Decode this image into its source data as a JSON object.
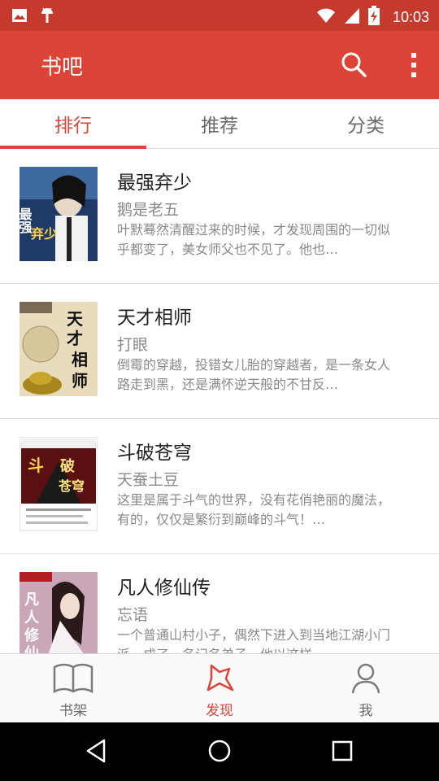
{
  "status_bar": {
    "time": "10:03",
    "icons": [
      "image-icon",
      "android-icon",
      "wifi-icon",
      "signal-icon",
      "battery-charging-icon"
    ]
  },
  "app_bar": {
    "title": "书吧",
    "actions": [
      "search-icon",
      "more-vert-icon"
    ]
  },
  "tabs": [
    {
      "label": "排行",
      "active": true
    },
    {
      "label": "推荐",
      "active": false
    },
    {
      "label": "分类",
      "active": false
    }
  ],
  "books": [
    {
      "title": "最强弃少",
      "author": "鹅是老五",
      "description": "叶默蓦然清醒过来的时候，才发现周围的一切似乎都变了，美女师父也不见了。他也…",
      "cover_text": "最强弃少"
    },
    {
      "title": "天才相师",
      "author": "打眼",
      "description": "倒霉的穿越，投错女儿胎的穿越者，是一条女人路走到黑，还是满怀逆天般的不甘反…",
      "cover_text": "天才相师"
    },
    {
      "title": "斗破苍穹",
      "author": "天蚕土豆",
      "description": "这里是属于斗气的世界，没有花俏艳丽的魔法，有的，仅仅是繁衍到巅峰的斗气！…",
      "cover_text": "斗破苍穹"
    },
    {
      "title": "凡人修仙传",
      "author": "忘语",
      "description": "一个普通山村小子，偶然下进入到当地江湖小门派，成了一名记名弟子。他以这样…",
      "cover_text": "凡人修仙传"
    }
  ],
  "bottom_nav": [
    {
      "label": "书架",
      "icon": "book-icon",
      "active": false
    },
    {
      "label": "发现",
      "icon": "star-icon",
      "active": true
    },
    {
      "label": "我",
      "icon": "person-icon",
      "active": false
    }
  ],
  "system_nav": [
    "back-icon",
    "home-icon",
    "recents-icon"
  ],
  "colors": {
    "primary": "#dc4437",
    "status_bar": "#c6392d",
    "text_secondary": "#8a8a8a"
  }
}
